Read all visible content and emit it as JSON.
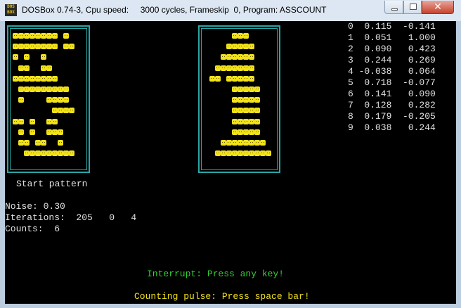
{
  "window": {
    "title": "DOSBox 0.74-3, Cpu speed:     3000 cycles, Frameskip  0, Program: ASSCOUNT",
    "icon_label": "DOS BOX",
    "close_glyph": "✕"
  },
  "patterns": {
    "start_label": "Start pattern",
    "start_rows": [
      "########.#",
      "########.##",
      "#.#..#",
      ".##..##",
      "########",
      ".#########",
      ".#....####",
      ".......####",
      "##.#..##",
      ".#.#..###",
      ".##.##..#",
      "..#########"
    ],
    "result_rows": [
      "....###",
      "...#####",
      "..######",
      ".#######",
      "##.#####",
      "....#####",
      "....#####",
      "....#####",
      "....#####",
      "....#####",
      "..########",
      ".##########"
    ]
  },
  "stats": {
    "noise": "Noise: 0.30",
    "iterations": "Iterations:  205   0   4",
    "counts": "Counts:  6"
  },
  "table": [
    {
      "idx": "0",
      "a": " 0.115",
      "b": "-0.141"
    },
    {
      "idx": "1",
      "a": " 0.051",
      "b": " 1.000"
    },
    {
      "idx": "2",
      "a": " 0.090",
      "b": " 0.423"
    },
    {
      "idx": "3",
      "a": " 0.244",
      "b": " 0.269"
    },
    {
      "idx": "4",
      "a": "-0.038",
      "b": " 0.064"
    },
    {
      "idx": "5",
      "a": " 0.718",
      "b": "-0.077"
    },
    {
      "idx": "6",
      "a": " 0.141",
      "b": " 0.090"
    },
    {
      "idx": "7",
      "a": " 0.128",
      "b": " 0.282"
    },
    {
      "idx": "8",
      "a": " 0.179",
      "b": "-0.205"
    },
    {
      "idx": "9",
      "a": " 0.038",
      "b": " 0.244"
    }
  ],
  "prompts": {
    "interrupt": "Interrupt: Press any key!",
    "counting": "Counting pulse: Press space bar!"
  },
  "colors": {
    "cell": "#f2e21a",
    "frame": "#2aa5a5",
    "interrupt_text": "#2fd12f",
    "counting_text": "#f2e21a"
  }
}
